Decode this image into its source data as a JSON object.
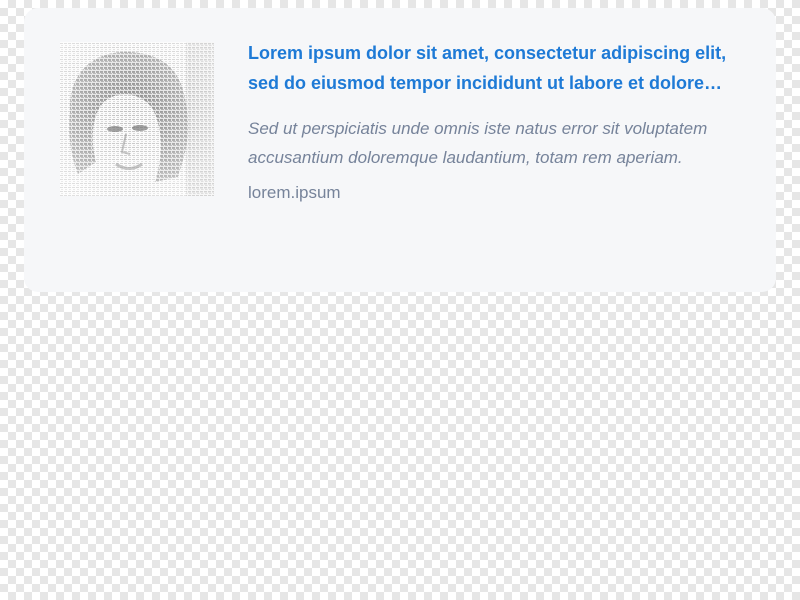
{
  "card": {
    "title": "Lorem ipsum dolor sit amet, consectetur adipiscing elit, sed do eiusmod tempor incididunt ut labore et dolore magna aliqua.",
    "description": "Sed ut perspiciatis unde omnis iste natus error sit voluptatem accusantium doloremque laudantium, totam rem aperiam.",
    "domain": "lorem.ipsum",
    "thumbnail": "text-portrait-image"
  },
  "colors": {
    "title": "#1e7ad6",
    "muted": "#76839a",
    "card_bg": "#f6f7f9"
  }
}
